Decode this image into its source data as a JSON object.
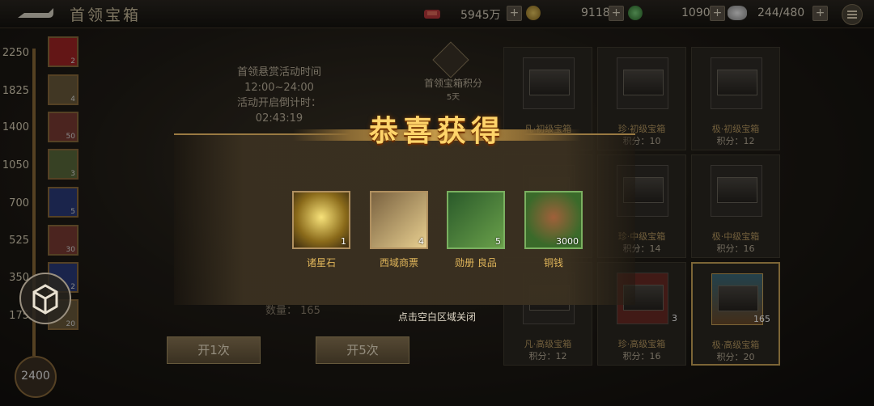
{
  "header": {
    "title": "首领宝箱"
  },
  "resources": [
    {
      "value": "5945万",
      "icon": "gold-ingot-icon",
      "color": "#c9a23a"
    },
    {
      "value": "9118",
      "icon": "jade-coin-icon",
      "color": "#4aa84a"
    },
    {
      "value": "1090",
      "icon": "silver-icon",
      "color": "#d8d8d8"
    },
    {
      "value": "244/480",
      "icon": "silver-icon",
      "color": "#d8d8d8"
    }
  ],
  "rail": {
    "ticks": [
      "2250",
      "1825",
      "1400",
      "1050",
      "700",
      "525",
      "350",
      "175"
    ],
    "items": [
      {
        "count": "2"
      },
      {
        "count": "4"
      },
      {
        "count": "50"
      },
      {
        "count": "3"
      },
      {
        "count": "5"
      },
      {
        "count": "30"
      },
      {
        "count": "2"
      },
      {
        "count": "20"
      }
    ],
    "bottom_value": "2400"
  },
  "event": {
    "line1": "首领悬赏活动时间",
    "time": "12:00~24:00",
    "countdown_label": "活动开启倒计时：",
    "countdown": "02:43:19"
  },
  "score": {
    "label": "首领宝箱积分",
    "sub": "5天"
  },
  "quantity_label": "数量： 165",
  "buttons": {
    "open1": "开1次",
    "open5": "开5次"
  },
  "chests": [
    {
      "name": "凡·初级宝箱",
      "points": ""
    },
    {
      "name": "珍·初级宝箱",
      "points": "积分：10"
    },
    {
      "name": "极·初级宝箱",
      "points": "积分：12"
    },
    {
      "name": "",
      "points": ""
    },
    {
      "name": "珍·中级宝箱",
      "points": "积分：14"
    },
    {
      "name": "极·中级宝箱",
      "points": "积分：16"
    },
    {
      "name": "凡·高级宝箱",
      "points": "积分：12",
      "count": ""
    },
    {
      "name": "珍·高级宝箱",
      "points": "积分：16",
      "count": "3"
    },
    {
      "name": "极·高级宝箱",
      "points": "积分：20",
      "count": "165"
    }
  ],
  "popup": {
    "title": "恭喜获得",
    "rewards": [
      {
        "name": "诸星石",
        "count": "1",
        "color": "#c9a84a"
      },
      {
        "name": "西域商票",
        "count": "4",
        "color": "#d8b670"
      },
      {
        "name": "勋册 良品",
        "count": "5",
        "color": "#4a8a3a"
      },
      {
        "name": "铜钱",
        "count": "3000",
        "color": "#4a8a3a"
      }
    ],
    "hint": "点击空白区域关闭"
  }
}
